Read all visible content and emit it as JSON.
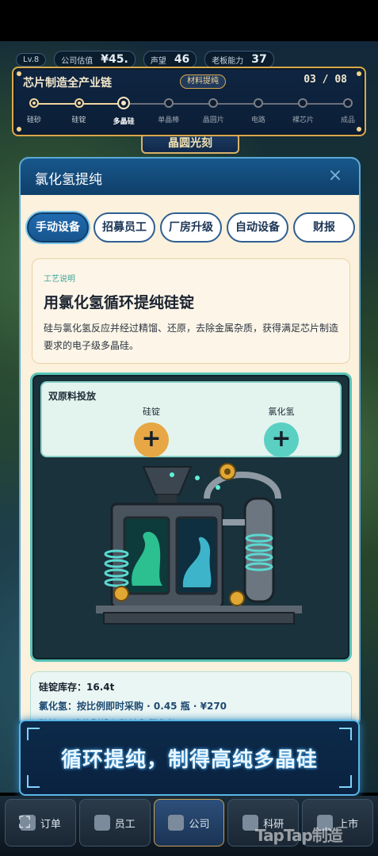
{
  "hud": {
    "level": "Lv.8",
    "company_value_label": "公司估值",
    "company_value": "¥45.",
    "reputation_label": "声望",
    "reputation": "46",
    "boss_ability_label": "老板能力",
    "boss_ability": "37"
  },
  "bg_banner": "晶圆光刻",
  "chain": {
    "title": "芯片制造全产业链",
    "badge": "材料提纯",
    "progress": "03 / 08",
    "current_index": 2,
    "steps": [
      "硅砂",
      "硅锭",
      "多晶硅",
      "单晶棒",
      "晶圆片",
      "电路",
      "裸芯片",
      "成品"
    ]
  },
  "modal": {
    "title": "氯化氢提纯",
    "close": "×",
    "tabs": [
      "手动设备",
      "招募员工",
      "厂房升级",
      "自动设备",
      "财报"
    ],
    "active_tab": 0,
    "process": {
      "tag": "工艺说明",
      "title": "用氯化氢循环提纯硅锭",
      "body": "硅与氯化氢反应并经过精馏、还原，去除金属杂质，获得满足芯片制造要求的电子级多晶硅。"
    },
    "feed": {
      "title": "双原料投放",
      "material_a": "硅锭",
      "material_b": "氯化氢",
      "plus": "+"
    },
    "stock": {
      "line1": "硅锭库存：16.4t",
      "line2": "氯化氢：按比例即时采购 · 0.45 瓶 · ¥270",
      "line3": "硅锭 → 请分别投入硅锭和氯化氢"
    }
  },
  "caption": "循环提纯，制得高纯多晶硅",
  "bottom_nav": [
    "订单",
    "员工",
    "公司",
    "科研",
    "上市"
  ],
  "fullscreen_icon": "⛶",
  "watermark": "TapTap制造",
  "colors": {
    "accent_blue": "#17558e",
    "gold": "#d9a94a",
    "teal": "#59c3b7",
    "orange_plus": "#e7a744",
    "teal_plus": "#5ad0c2"
  }
}
